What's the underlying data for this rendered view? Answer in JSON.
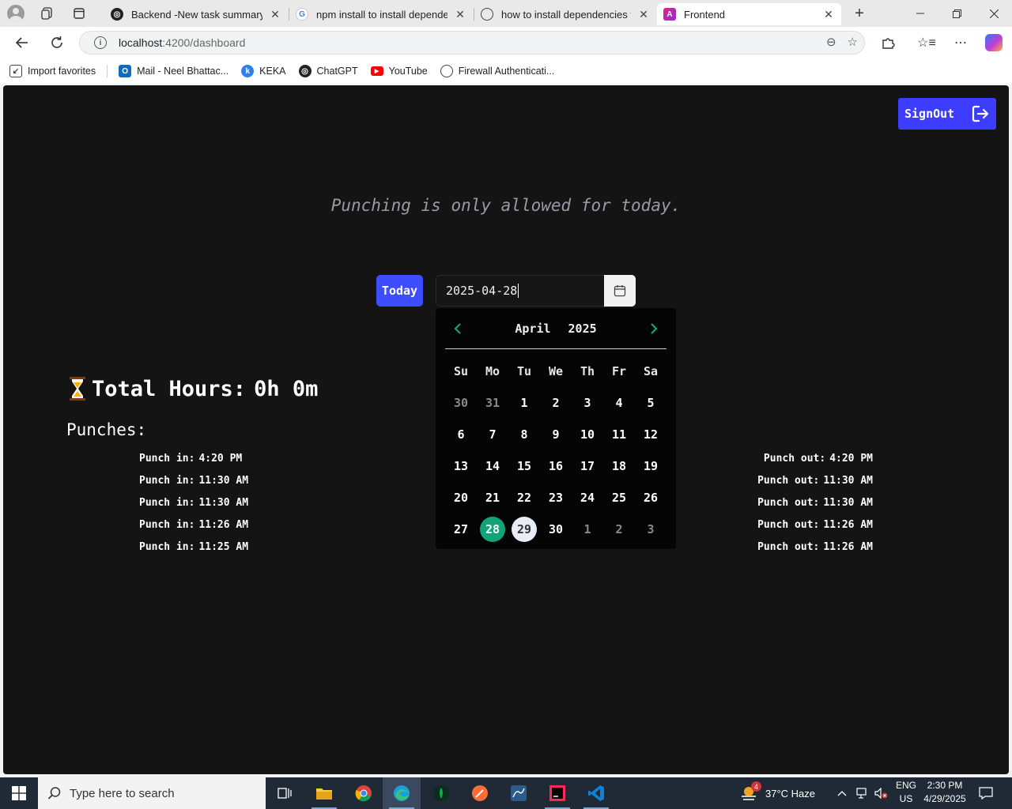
{
  "browser": {
    "tabs": [
      {
        "label": "Backend -New task summary",
        "favicon": "chatgpt-icon"
      },
      {
        "label": "npm install to install dependencies",
        "favicon": "google-icon"
      },
      {
        "label": "how to install dependencies for j",
        "favicon": "globe-icon"
      },
      {
        "label": "Frontend",
        "favicon": "angular-icon"
      }
    ],
    "new_tab_symbol": "+",
    "url_host": "localhost",
    "url_rest": ":4200/dashboard",
    "favorites": [
      {
        "label": "Import favorites",
        "icon": "import-icon"
      },
      {
        "label": "Mail - Neel Bhattac...",
        "icon": "outlook-icon"
      },
      {
        "label": "KEKA",
        "icon": "keka-icon"
      },
      {
        "label": "ChatGPT",
        "icon": "chatgpt-icon"
      },
      {
        "label": "YouTube",
        "icon": "youtube-icon"
      },
      {
        "label": "Firewall Authenticati...",
        "icon": "globe-icon"
      }
    ]
  },
  "page": {
    "signout_label": "SignOut",
    "notice": "Punching is only allowed for today.",
    "today_label": "Today",
    "date_value": "2025-04-28",
    "datepicker": {
      "month": "April",
      "year": "2025",
      "weekdays": [
        "Su",
        "Mo",
        "Tu",
        "We",
        "Th",
        "Fr",
        "Sa"
      ],
      "weeks": [
        [
          "30",
          "31",
          "1",
          "2",
          "3",
          "4",
          "5"
        ],
        [
          "6",
          "7",
          "8",
          "9",
          "10",
          "11",
          "12"
        ],
        [
          "13",
          "14",
          "15",
          "16",
          "17",
          "18",
          "19"
        ],
        [
          "20",
          "21",
          "22",
          "23",
          "24",
          "25",
          "26"
        ],
        [
          "27",
          "28",
          "29",
          "30",
          "1",
          "2",
          "3"
        ]
      ],
      "selected_day": "28",
      "today_day": "29",
      "accent_color": "#12a37a"
    },
    "total_hours_label": "Total Hours:",
    "total_hours_value": "0h 0m",
    "punches_title": "Punches:",
    "punch_in_label": "Punch in:",
    "punch_out_label": "Punch out:",
    "punches": [
      {
        "in": "4:20 PM",
        "out": "4:20 PM"
      },
      {
        "in": "11:30 AM",
        "out": "11:30 AM"
      },
      {
        "in": "11:30 AM",
        "out": "11:30 AM"
      },
      {
        "in": "11:26 AM",
        "out": "11:26 AM"
      },
      {
        "in": "11:25 AM",
        "out": "11:26 AM"
      }
    ],
    "brand_color": "#3d3dff"
  },
  "taskbar": {
    "search_placeholder": "Type here to search",
    "weather": "37°C  Haze",
    "weather_badge": "4",
    "lang_top": "ENG",
    "lang_bottom": "US",
    "time": "2:30 PM",
    "date": "4/29/2025"
  }
}
